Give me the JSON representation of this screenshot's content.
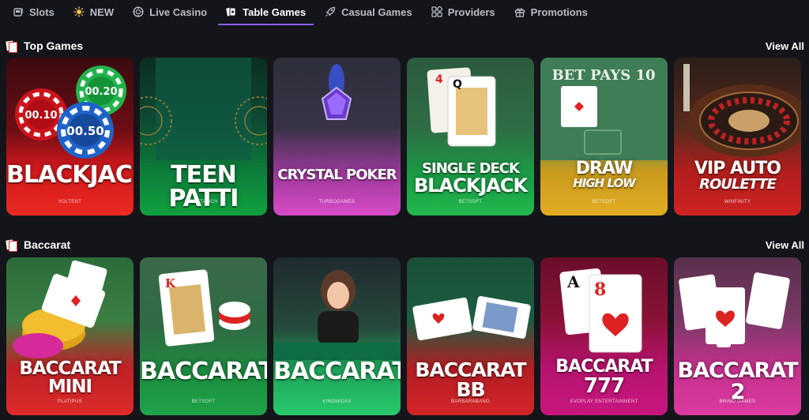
{
  "nav": {
    "items": [
      {
        "label": "Slots",
        "icon": "slot-machine-icon",
        "active": false
      },
      {
        "label": "NEW",
        "icon": "sparkle-icon",
        "active": false
      },
      {
        "label": "Live Casino",
        "icon": "poker-chip-icon",
        "active": false
      },
      {
        "label": "Table Games",
        "icon": "cards-icon",
        "active": true
      },
      {
        "label": "Casual Games",
        "icon": "rocket-icon",
        "active": false
      },
      {
        "label": "Providers",
        "icon": "grid-icon",
        "active": false
      },
      {
        "label": "Promotions",
        "icon": "gift-icon",
        "active": false
      }
    ]
  },
  "top_games": {
    "title": "Top Games",
    "view_all": "View All",
    "cards": [
      {
        "title": "BLACKJACK",
        "title2": "",
        "provider": "VOLTENT",
        "bg": "#e0201f",
        "chips": [
          "00.10",
          "00.20",
          "00.50"
        ]
      },
      {
        "title": "TEEN PATTI",
        "title2": "",
        "provider": "ONETOUCH",
        "bg": "#0f8a3a"
      },
      {
        "title": "CRYSTAL POKER",
        "title2": "",
        "provider": "TURBOGAMES",
        "bg": "#c63fb4"
      },
      {
        "title": "SINGLE DECK",
        "title2": "BLACKJACK",
        "provider": "BETSOFT",
        "bg": "#1fa64a",
        "cards": [
          "4",
          "Q"
        ]
      },
      {
        "title": "DRAW",
        "title2": "HIGH LOW",
        "provider": "BETSOFT",
        "bg": "#e0a21a",
        "felt": "BET PAYS 10"
      },
      {
        "title": "VIP AUTO",
        "title2": "ROULETTE",
        "provider": "WINFINITY",
        "bg": "#c41e1e"
      }
    ]
  },
  "baccarat": {
    "title": "Baccarat",
    "view_all": "View All",
    "cards": [
      {
        "title": "BACCARAT MINI",
        "title2": "",
        "provider": "PLATIPUS",
        "bg": "#d62828"
      },
      {
        "title": "BACCARAT",
        "title2": "",
        "provider": "BETSOFT",
        "bg": "#1f9a45",
        "cards": [
          "K"
        ]
      },
      {
        "title": "BACCARAT",
        "title2": "",
        "provider": "KINGMIDAS",
        "bg": "#1fbf6a"
      },
      {
        "title": "BACCARAT BB",
        "title2": "",
        "provider": "BARBARABANG",
        "bg": "#d52626"
      },
      {
        "title": "BACCARAT",
        "title2": "777",
        "provider": "EVOPLAY ENTERTAINMENT",
        "bg": "#c2167d",
        "cards": [
          "A",
          "8"
        ]
      },
      {
        "title": "BACCARAT 2",
        "title2": "",
        "provider": "BRINO GAMES",
        "bg": "#d7339a"
      }
    ]
  }
}
